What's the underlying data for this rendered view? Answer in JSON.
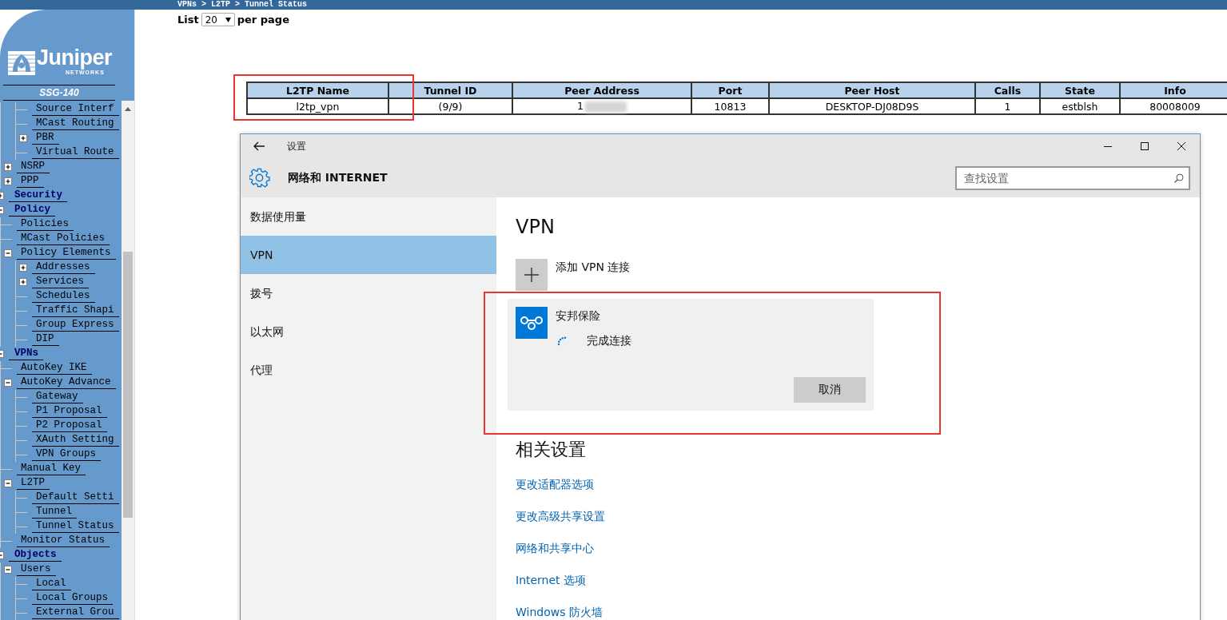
{
  "breadcrumb": "VPNs > L2TP > Tunnel Status",
  "logo": {
    "name": "Juniper",
    "subtitle": "NETWORKS",
    "device": "SSG-140"
  },
  "nav_tree": [
    {
      "children": [
        {
          "children": [
            {
              "label": "Source Interf"
            },
            {
              "label": "MCast Routing"
            },
            {
              "label": "PBR",
              "expanded": false
            },
            {
              "label": "Virtual Route"
            }
          ]
        },
        {
          "label": "NSRP",
          "expanded": false
        },
        {
          "label": "PPP",
          "expanded": false
        }
      ]
    },
    {
      "label": "Security",
      "expanded": false
    },
    {
      "label": "Policy",
      "expanded": true,
      "children": [
        {
          "label": "Policies"
        },
        {
          "label": "MCast Policies"
        },
        {
          "label": "Policy Elements",
          "expanded": true,
          "children": [
            {
              "label": "Addresses",
              "expanded": false
            },
            {
              "label": "Services",
              "expanded": false
            },
            {
              "label": "Schedules"
            },
            {
              "label": "Traffic Shapi"
            },
            {
              "label": "Group Express"
            },
            {
              "label": "DIP"
            }
          ]
        }
      ]
    },
    {
      "label": "VPNs",
      "expanded": true,
      "children": [
        {
          "label": "AutoKey IKE"
        },
        {
          "label": "AutoKey Advance",
          "expanded": true,
          "children": [
            {
              "label": "Gateway"
            },
            {
              "label": "P1 Proposal"
            },
            {
              "label": "P2 Proposal"
            },
            {
              "label": "XAuth Setting"
            },
            {
              "label": "VPN Groups"
            }
          ]
        },
        {
          "label": "Manual Key"
        },
        {
          "label": "L2TP",
          "expanded": true,
          "children": [
            {
              "label": "Default Setti"
            },
            {
              "label": "Tunnel"
            },
            {
              "label": "Tunnel Status"
            }
          ]
        },
        {
          "label": "Monitor Status"
        }
      ]
    },
    {
      "label": "Objects",
      "expanded": true,
      "children": [
        {
          "label": "Users",
          "expanded": true,
          "children": [
            {
              "label": "Local"
            },
            {
              "label": "Local Groups"
            },
            {
              "label": "External Grou"
            }
          ]
        }
      ]
    }
  ],
  "list_control": {
    "label": "List",
    "value": "20",
    "suffix": "per page"
  },
  "tunnel_table": {
    "columns": [
      "L2TP Name",
      "Tunnel ID",
      "Peer Address",
      "Port",
      "Peer Host",
      "Calls",
      "State",
      "Info"
    ],
    "rows": [
      [
        "l2tp_vpn",
        "(9/9)",
        "1",
        "10813",
        "DESKTOP-DJ08D9S",
        "1",
        "estblsh",
        "80008009"
      ]
    ]
  },
  "settings_window": {
    "title": "设置",
    "section": "网络和 INTERNET",
    "search_placeholder": "查找设置",
    "nav": [
      {
        "label": "数据使用量",
        "selected": false
      },
      {
        "label": "VPN",
        "selected": true
      },
      {
        "label": "拨号",
        "selected": false
      },
      {
        "label": "以太网",
        "selected": false
      },
      {
        "label": "代理",
        "selected": false
      }
    ],
    "heading": "VPN",
    "add_button": "添加 VPN 连接",
    "connections": [
      {
        "name": "安邦保险",
        "status": "完成连接",
        "action": "取消"
      }
    ],
    "related_heading": "相关设置",
    "links": [
      "更改适配器选项",
      "更改高级共享设置",
      "网络和共享中心",
      "Internet 选项",
      "Windows 防火墙"
    ]
  }
}
